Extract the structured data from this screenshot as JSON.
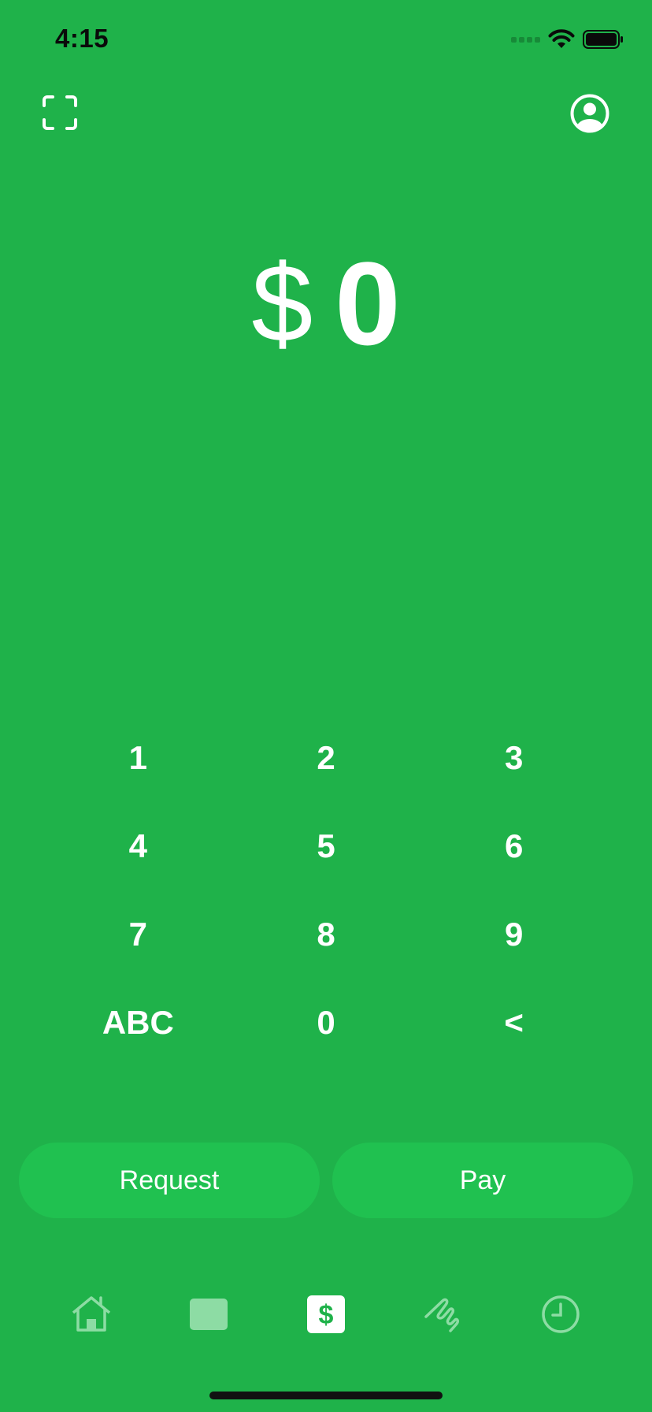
{
  "status_bar": {
    "time": "4:15",
    "icons": [
      "cellular-signal-icon",
      "wifi-icon",
      "battery-icon"
    ]
  },
  "header": {
    "left_icon": "qr-scan-icon",
    "right_icon": "profile-icon"
  },
  "amount": {
    "currency": "$",
    "value": "0"
  },
  "keypad": {
    "keys": [
      "1",
      "2",
      "3",
      "4",
      "5",
      "6",
      "7",
      "8",
      "9",
      "ABC",
      "0",
      "<"
    ]
  },
  "actions": {
    "request_label": "Request",
    "pay_label": "Pay"
  },
  "tab_bar": {
    "tabs": [
      "home-icon",
      "card-icon",
      "dollar-icon",
      "investing-icon",
      "activity-clock-icon"
    ],
    "active": "dollar-icon"
  },
  "colors": {
    "background": "#1fb24a",
    "button": "#20c150",
    "foreground": "#ffffff",
    "inactive_tab": "#8ddca4"
  }
}
